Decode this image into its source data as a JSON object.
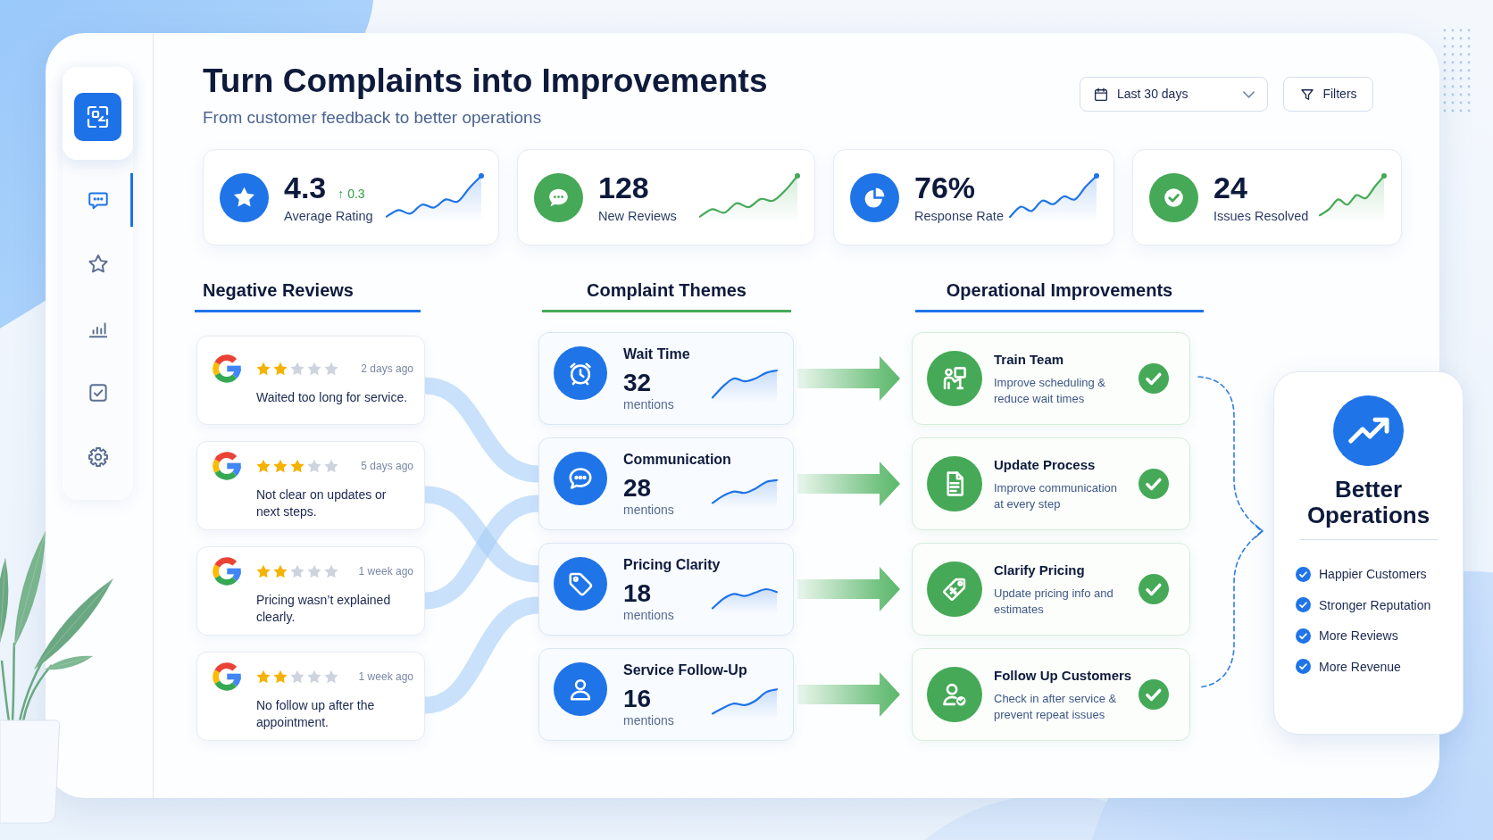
{
  "sidebar": {
    "items": [
      {
        "kind": "chat",
        "selected": true
      },
      {
        "kind": "star",
        "selected": false
      },
      {
        "kind": "chart",
        "selected": false
      },
      {
        "kind": "tasks",
        "selected": false
      },
      {
        "kind": "settings",
        "selected": false
      }
    ]
  },
  "header": {
    "title": "Turn Complaints into Improvements",
    "subtitle": "From customer feedback to better operations",
    "date_range": "Last 30 days",
    "filters": "Filters"
  },
  "stats": [
    {
      "kind": "star",
      "color": "#1f74e8",
      "value": "4.3",
      "delta": "↑ 0.3",
      "label": "Average Rating"
    },
    {
      "kind": "chat",
      "color": "#45a957",
      "value": "128",
      "label": "New Reviews"
    },
    {
      "kind": "pie",
      "color": "#1f74e8",
      "value": "76%",
      "label": "Response Rate"
    },
    {
      "kind": "check",
      "color": "#45a957",
      "value": "24",
      "label": "Issues Resolved"
    }
  ],
  "negative_reviews": {
    "title": "Negative Reviews",
    "reviews": [
      {
        "stars": 2,
        "time": "2 days ago",
        "text": "Waited too long for service."
      },
      {
        "stars": 3,
        "time": "5 days ago",
        "text": "Not clear on updates or next steps."
      },
      {
        "stars": 2,
        "time": "1 week ago",
        "text": "Pricing wasn’t explained clearly."
      },
      {
        "stars": 2,
        "time": "1 week ago",
        "text": "No follow up after the appointment."
      }
    ]
  },
  "complaint_themes": {
    "title": "Complaint Themes",
    "themes": [
      {
        "kind": "clock",
        "name": "Wait Time",
        "count": "32",
        "unit": "mentions"
      },
      {
        "kind": "chat",
        "name": "Communication",
        "count": "28",
        "unit": "mentions"
      },
      {
        "kind": "tag",
        "name": "Pricing Clarity",
        "count": "18",
        "unit": "mentions"
      },
      {
        "kind": "person",
        "name": "Service Follow-Up",
        "count": "16",
        "unit": "mentions"
      }
    ]
  },
  "operational_improvements": {
    "title": "Operational Improvements",
    "items": [
      {
        "kind": "trainer",
        "title": "Train Team",
        "description": "Improve scheduling & reduce wait times",
        "done": true
      },
      {
        "kind": "document",
        "title": "Update Process",
        "description": "Improve communication at every step",
        "done": true
      },
      {
        "kind": "price-tag",
        "title": "Clarify Pricing",
        "description": "Update pricing info and estimates",
        "done": true
      },
      {
        "kind": "person-check",
        "title": "Follow Up Customers",
        "description": "Check in after service & prevent repeat issues",
        "done": true
      }
    ]
  },
  "outcome": {
    "title": "Better Operations",
    "benefits": [
      "Happier Customers",
      "Stronger Reputation",
      "More Reviews",
      "More Revenue"
    ]
  }
}
